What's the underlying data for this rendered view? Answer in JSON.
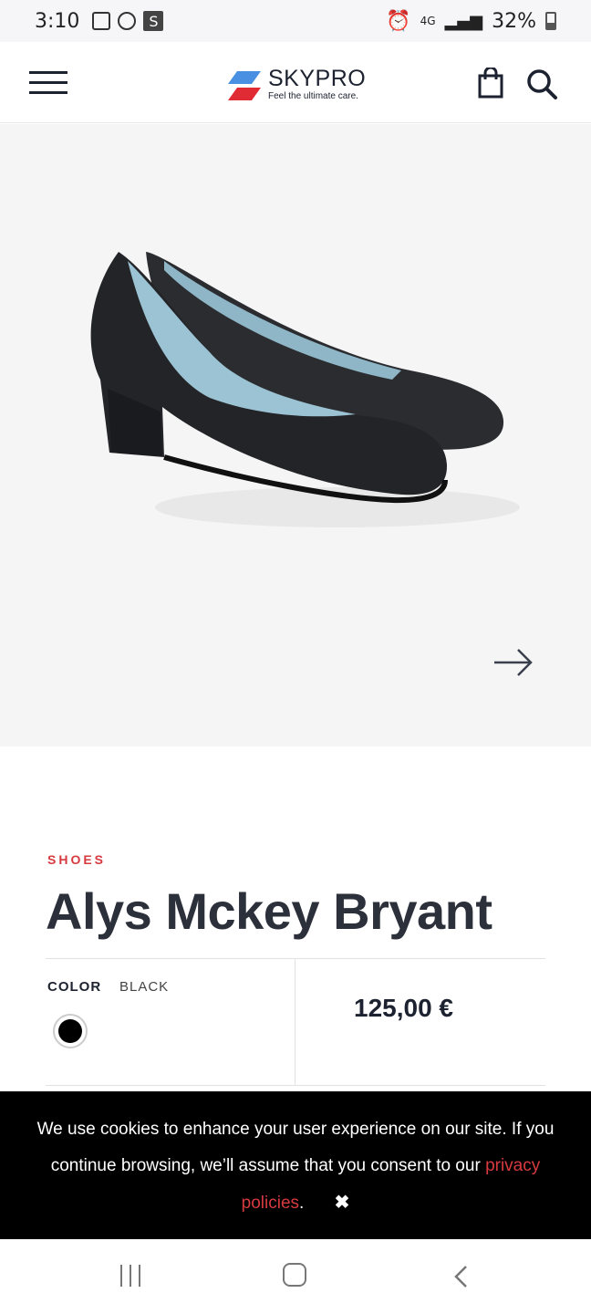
{
  "status": {
    "time": "3:10",
    "network": "4G",
    "battery": "32%"
  },
  "header": {
    "brand": "SKYPRO",
    "tagline": "Feel the ultimate care.",
    "icons": [
      "menu-icon",
      "bag-icon",
      "search-icon"
    ]
  },
  "product": {
    "category": "SHOES",
    "name": "Alys Mckey Bryant",
    "color_label": "COLOR",
    "color_value": "BLACK",
    "swatch_color": "#000000",
    "price": "125,00 €"
  },
  "cookie": {
    "text1": "We use cookies to enhance your user experience on our site. If you continue browsing, we’ll assume that you consent to our ",
    "link": "privacy policies",
    "period": ".",
    "close": "✖"
  },
  "colors": {
    "accent": "#d63a3f",
    "dark": "#1d2230",
    "gallery_bg": "#f5f5f5"
  }
}
